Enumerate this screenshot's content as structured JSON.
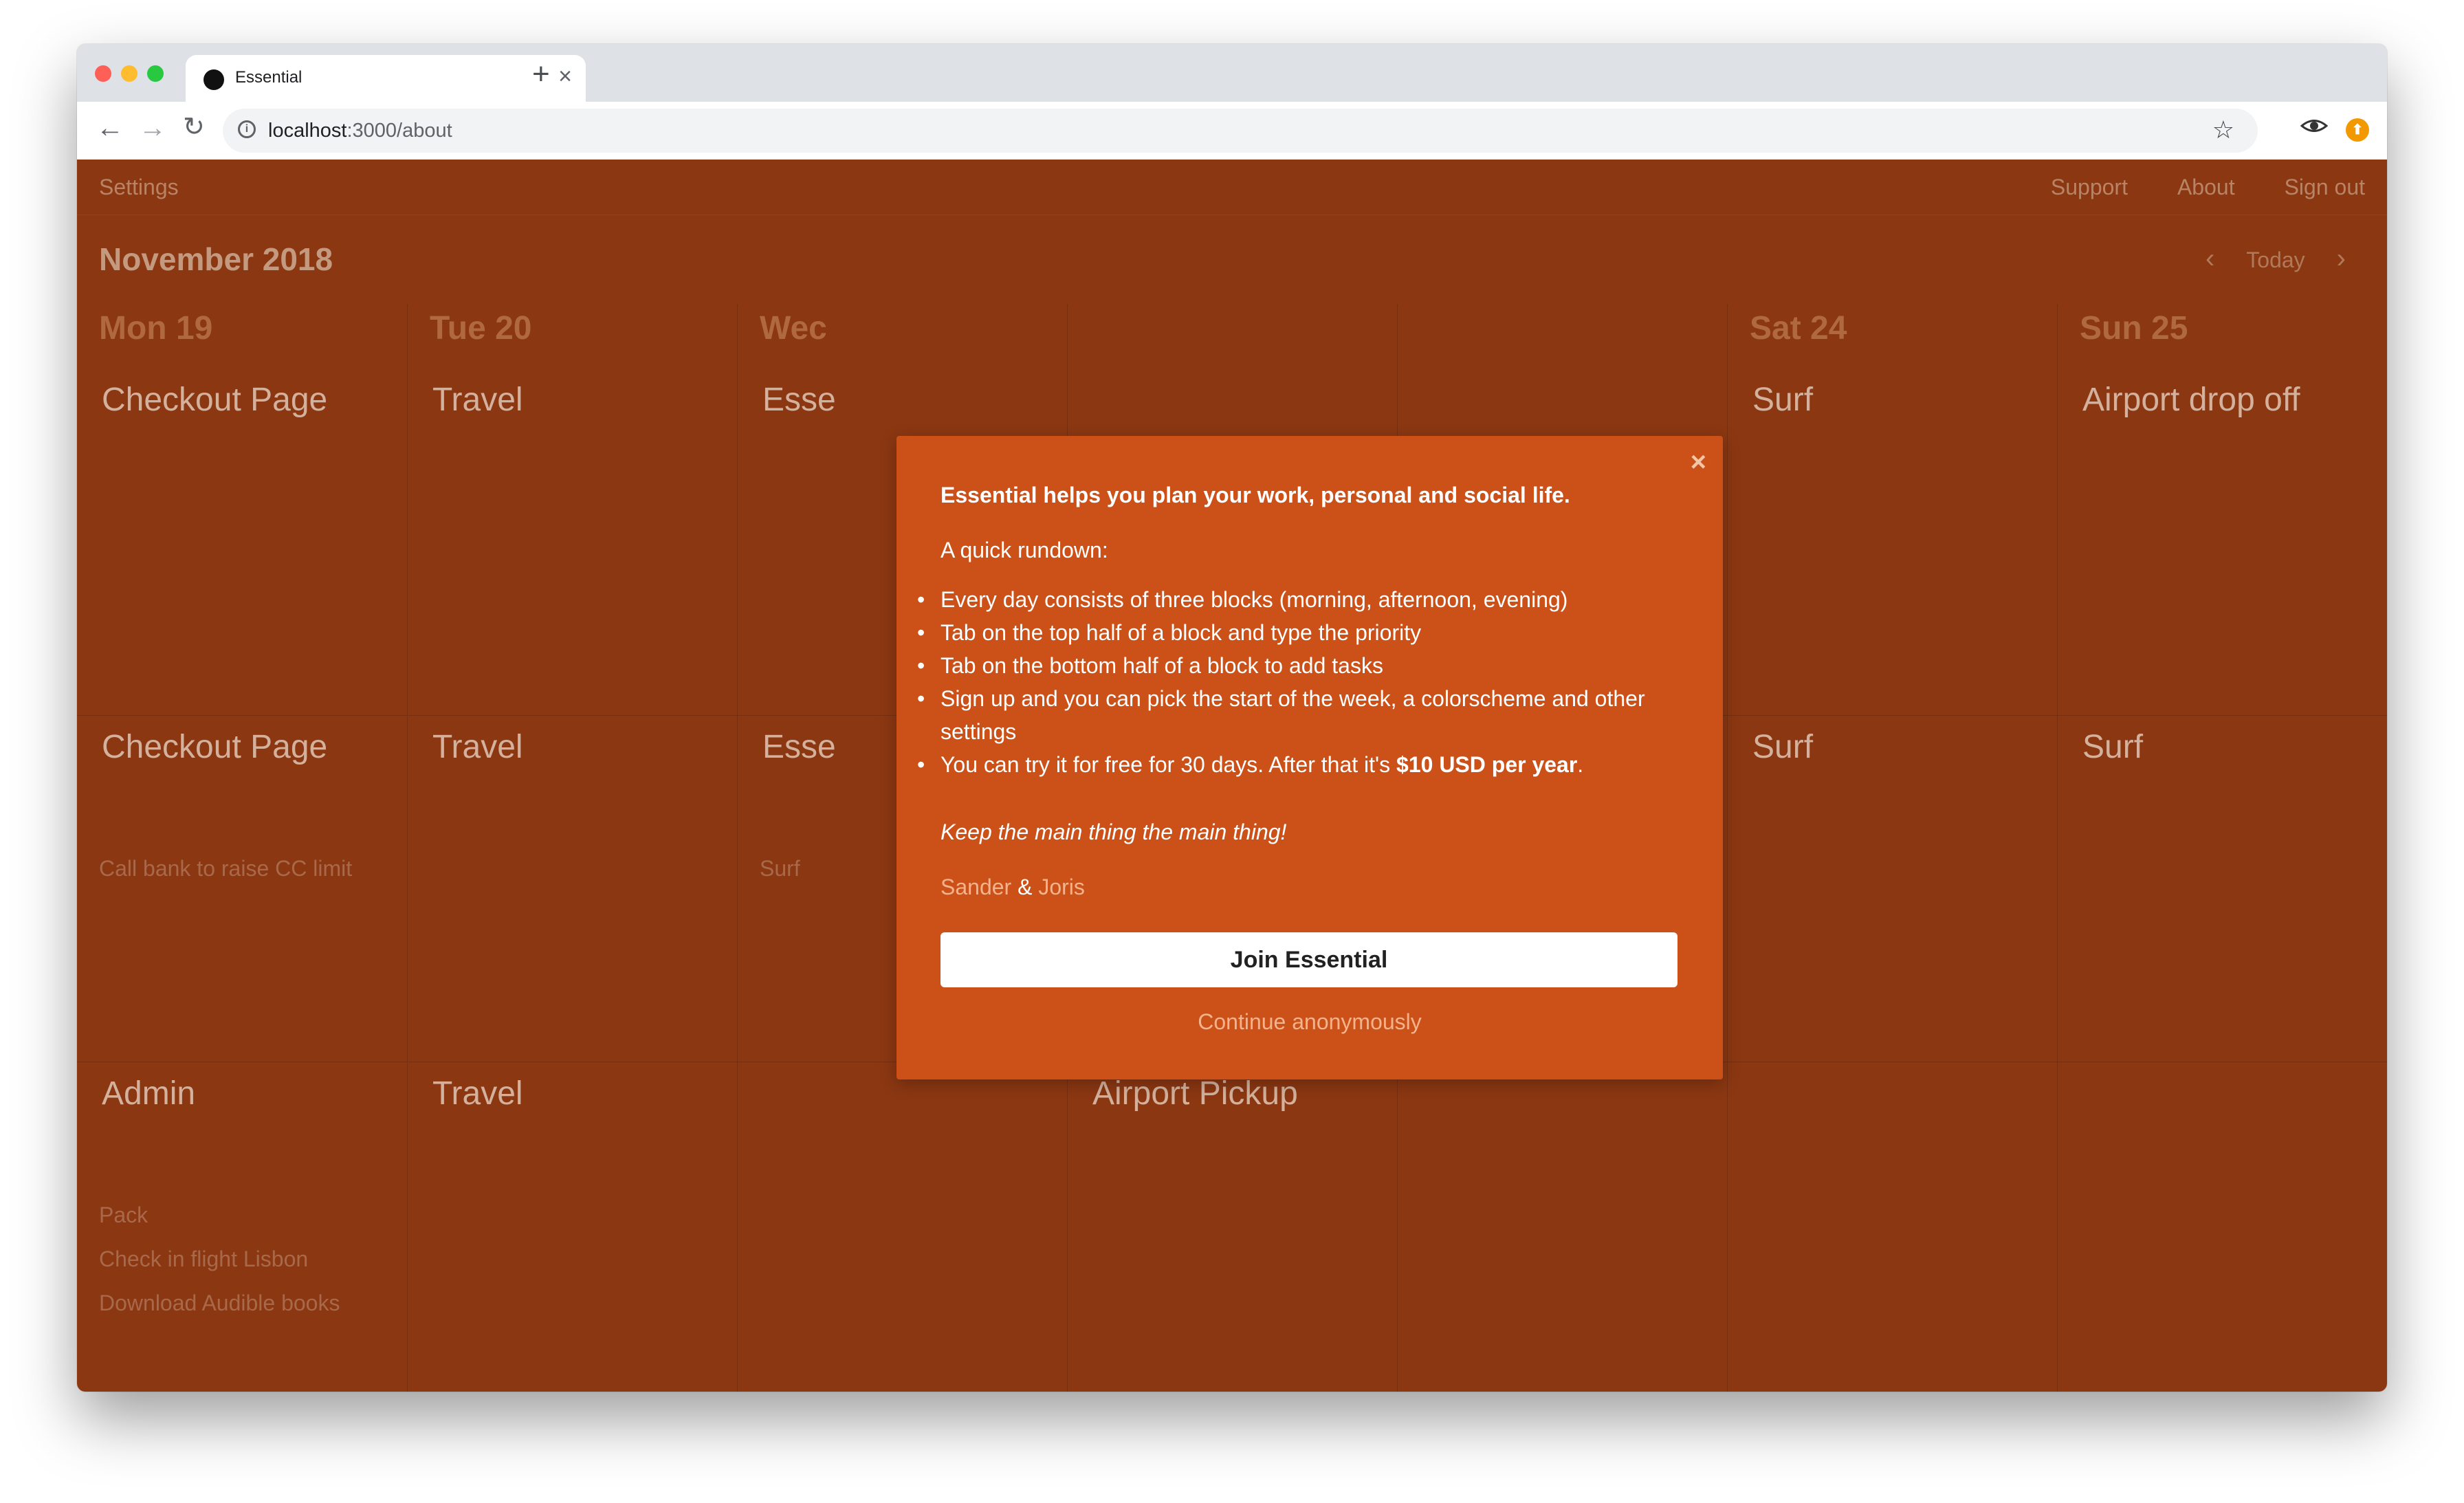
{
  "browser": {
    "tab_title": "Essential",
    "tab_close": "×",
    "new_tab": "+",
    "url_host": "localhost",
    "url_path": ":3000/about",
    "back_icon": "←",
    "forward_icon": "→",
    "reload_icon": "↻",
    "info_icon": "i",
    "star_icon": "☆"
  },
  "app": {
    "nav": {
      "settings": "Settings",
      "support": "Support",
      "about": "About",
      "sign_out": "Sign out"
    },
    "month_title": "November 2018",
    "week_nav": {
      "prev": "‹",
      "today": "Today",
      "next": "›"
    },
    "days": [
      {
        "label": "Mon 19",
        "blocks": [
          {
            "priority": "Checkout Page",
            "tasks": []
          },
          {
            "priority": "Checkout Page",
            "tasks": [
              "Call bank to raise CC limit"
            ]
          },
          {
            "priority": "Admin",
            "tasks": [
              "Pack",
              "Check in flight Lisbon",
              "Download Audible books"
            ]
          }
        ]
      },
      {
        "label": "Tue 20",
        "blocks": [
          {
            "priority": "Travel",
            "tasks": []
          },
          {
            "priority": "Travel",
            "tasks": []
          },
          {
            "priority": "Travel",
            "tasks": []
          }
        ]
      },
      {
        "label": "Wec",
        "blocks": [
          {
            "priority": "Esse",
            "tasks": []
          },
          {
            "priority": "Esse",
            "tasks": [
              "Surf"
            ]
          },
          {
            "priority": "",
            "tasks": []
          }
        ]
      },
      {
        "label": "",
        "blocks": [
          {
            "priority": "",
            "tasks": []
          },
          {
            "priority": "",
            "tasks": []
          },
          {
            "priority": "Airport Pickup",
            "tasks": []
          }
        ]
      },
      {
        "label": "",
        "blocks": [
          {
            "priority": "",
            "tasks": []
          },
          {
            "priority": "",
            "tasks": []
          },
          {
            "priority": "",
            "tasks": []
          }
        ]
      },
      {
        "label": "Sat 24",
        "blocks": [
          {
            "priority": "Surf",
            "tasks": []
          },
          {
            "priority": "Surf",
            "tasks": []
          },
          {
            "priority": "",
            "tasks": []
          }
        ]
      },
      {
        "label": "Sun 25",
        "blocks": [
          {
            "priority": "Airport drop off",
            "tasks": []
          },
          {
            "priority": "Surf",
            "tasks": []
          },
          {
            "priority": "",
            "tasks": []
          }
        ]
      }
    ]
  },
  "modal": {
    "close": "×",
    "intro": "Essential helps you plan your work, personal and social life.",
    "rundown": "A quick rundown:",
    "bullets": [
      "Every day consists of three blocks (morning, afternoon, evening)",
      "Tab on the top half of a block and type the priority",
      "Tab on the bottom half of a block to add tasks",
      "Sign up and you can pick the start of the week, a colorscheme and other settings"
    ],
    "trial_text": "You can try it for free for 30 days. After that it's ",
    "trial_price": "$10 USD per year",
    "trial_end": ".",
    "motto": "Keep the main thing the main thing!",
    "author1": "Sander",
    "amp": " & ",
    "author2": "Joris",
    "join_label": "Join Essential",
    "anon_label": "Continue anonymously"
  },
  "colors": {
    "page_bg": "#8b3712",
    "modal_bg": "#cb5119",
    "link": "#f4b38c"
  }
}
